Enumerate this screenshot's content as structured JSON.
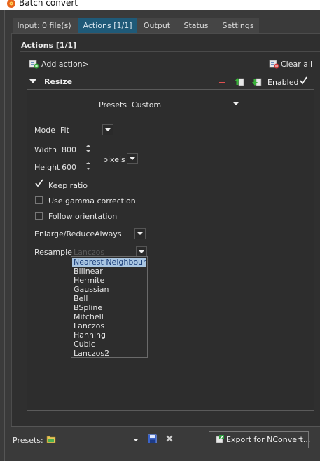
{
  "window": {
    "title": "Batch convert"
  },
  "tabs": [
    {
      "label": "Input: 0 file(s)"
    },
    {
      "label": "Actions [1/1]"
    },
    {
      "label": "Output"
    },
    {
      "label": "Status"
    },
    {
      "label": "Settings"
    }
  ],
  "panel": {
    "title": "Actions [1/1]",
    "add_action_label": "Add action>",
    "clear_all_label": "Clear all"
  },
  "action": {
    "title": "Resize",
    "enabled_label": "Enabled",
    "enabled": true,
    "presets_label": "Presets",
    "presets_value": "Custom",
    "mode_label": "Mode",
    "mode_value": "Fit",
    "width_label": "Width",
    "width_value": "800",
    "height_label": "Height",
    "height_value": "600",
    "unit_value": "pixels",
    "keep_ratio_label": "Keep ratio",
    "keep_ratio": true,
    "gamma_label": "Use gamma correction",
    "gamma": false,
    "orientation_label": "Follow orientation",
    "orientation": false,
    "enlarge_label": "Enlarge/Reduce",
    "enlarge_value": "Always",
    "resample_label": "Resample",
    "resample_value": "Lanczos",
    "resample_options": [
      "Nearest Neighbour",
      "Bilinear",
      "Hermite",
      "Gaussian",
      "Bell",
      "BSpline",
      "Mitchell",
      "Lanczos",
      "Hanning",
      "Cubic",
      "Lanczos2"
    ],
    "resample_highlighted": "Nearest Neighbour"
  },
  "footer": {
    "presets_label": "Presets:",
    "export_label": "Export for NConvert..."
  },
  "colors": {
    "accent_tab": "#1f5a78",
    "highlight": "#a9c6e2",
    "remove": "#e05050"
  }
}
